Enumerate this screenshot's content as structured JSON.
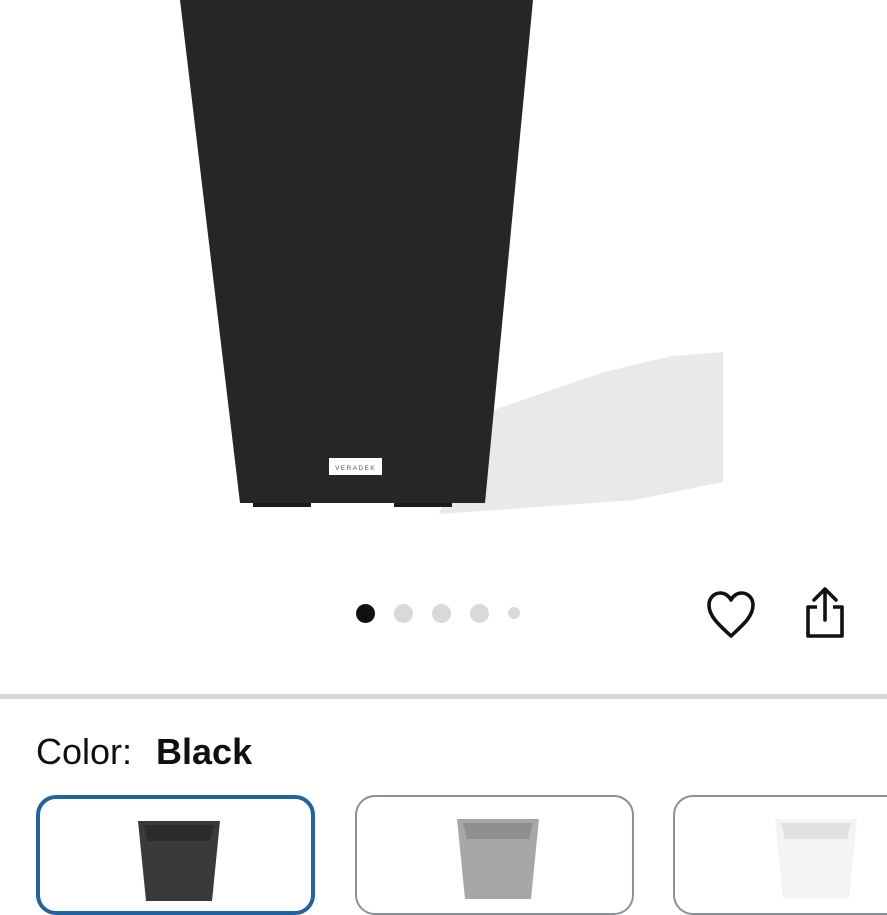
{
  "product_image": {
    "brand_tag": "VERADEK",
    "planter_color": "#262626"
  },
  "carousel": {
    "total": 5,
    "active_index": 0
  },
  "actions": {
    "favorite_icon": "heart-icon",
    "share_icon": "share-icon"
  },
  "color_selector": {
    "label": "Color:",
    "selected_value": "Black",
    "swatches": [
      {
        "name": "Black",
        "fill": "#3a3a3a",
        "selected": true
      },
      {
        "name": "Grey",
        "fill": "#a7a7a7",
        "selected": false
      },
      {
        "name": "White",
        "fill": "#f4f4f4",
        "selected": false
      }
    ]
  },
  "colors": {
    "selected_border": "#2162a1",
    "unselected_border": "#8d9096",
    "divider": "#d5d9d9"
  }
}
